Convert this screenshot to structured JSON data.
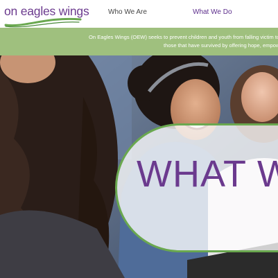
{
  "header": {
    "logo_text": "on eagles wings",
    "nav": [
      {
        "label": "Who We Are"
      },
      {
        "label": "What We Do"
      }
    ]
  },
  "mission": {
    "line1": "On Eagles Wings (OEW) seeks to prevent children and youth from falling victim to se",
    "line2": "those that have survived by offering hope, empowe"
  },
  "hero": {
    "title": "WHAT W"
  },
  "colors": {
    "brand_purple": "#6b3a8e",
    "nav_active": "#5c2d8c",
    "band_green": "#9fc07e",
    "oval_border": "#6aa84f"
  }
}
